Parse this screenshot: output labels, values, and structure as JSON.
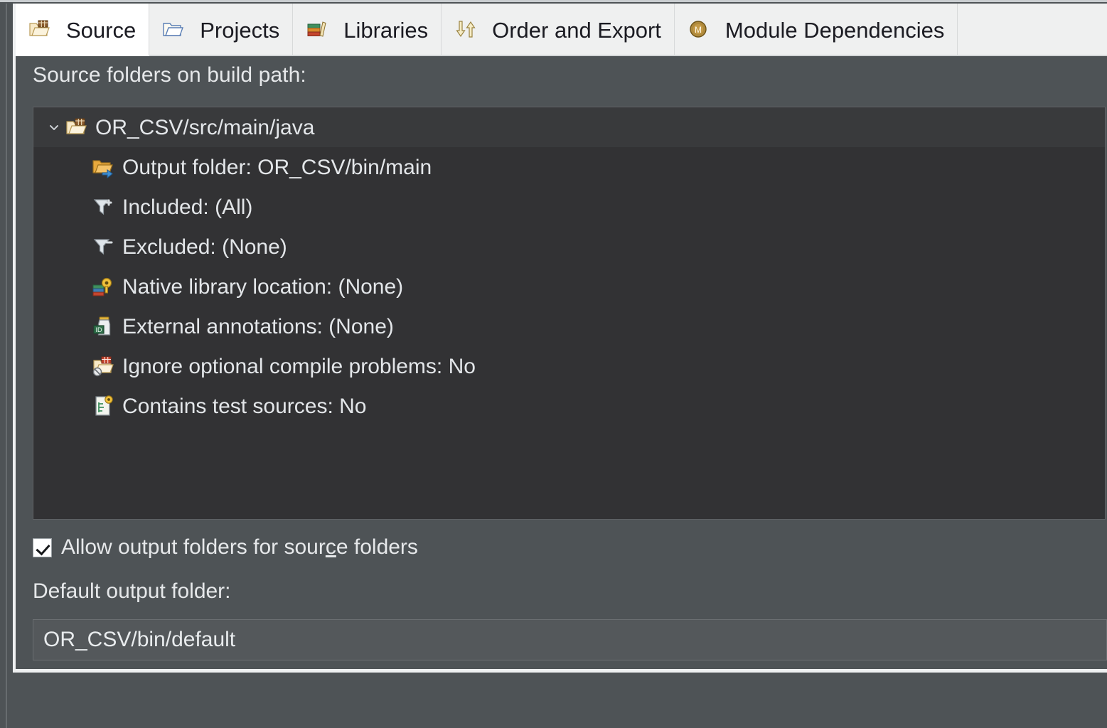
{
  "tabs": [
    {
      "label": "Source",
      "icon": "source-folder-icon",
      "selected": true
    },
    {
      "label": "Projects",
      "icon": "open-folder-icon",
      "selected": false
    },
    {
      "label": "Libraries",
      "icon": "books-icon",
      "selected": false
    },
    {
      "label": "Order and Export",
      "icon": "up-down-arrows-icon",
      "selected": false
    },
    {
      "label": "Module Dependencies",
      "icon": "module-badge-icon",
      "selected": false
    }
  ],
  "section": {
    "label": "Source folders on build path:"
  },
  "tree": {
    "root": {
      "label": "OR_CSV/src/main/java",
      "icon": "source-folder-icon",
      "expander": "chevron-down-icon",
      "expanded": true,
      "selected": true
    },
    "children": [
      {
        "label": "Output folder: OR_CSV/bin/main",
        "icon": "output-folder-icon"
      },
      {
        "label": "Included: (All)",
        "icon": "filter-include-icon"
      },
      {
        "label": "Excluded: (None)",
        "icon": "filter-exclude-icon"
      },
      {
        "label": "Native library location: (None)",
        "icon": "native-library-icon"
      },
      {
        "label": "External annotations: (None)",
        "icon": "external-annotations-icon"
      },
      {
        "label": "Ignore optional compile problems: No",
        "icon": "ignore-problems-icon"
      },
      {
        "label": "Contains test sources: No",
        "icon": "test-sources-icon"
      }
    ]
  },
  "allow_output": {
    "label_before": "Allow output folders for sour",
    "label_mnemonic": "c",
    "label_after": "e folders",
    "checked": true
  },
  "default_output": {
    "label": "Default output folder:",
    "value": "OR_CSV/bin/default",
    "placeholder": "Default output folder"
  },
  "colors": {
    "panel_bg": "#4e5356",
    "tree_bg": "#323234",
    "tab_bg": "#eff0f0",
    "tab_selected_bg": "#ffffff",
    "text_light": "#e6e8ea",
    "text_dark": "#1b1b22",
    "field_bg": "#54585b"
  }
}
